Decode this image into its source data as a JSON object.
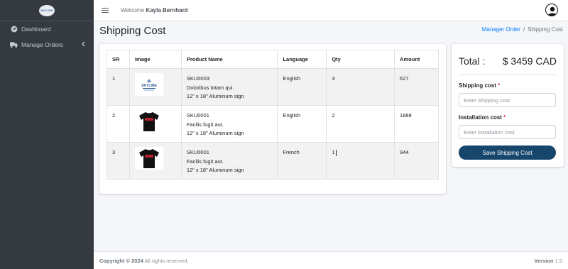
{
  "sidebar": {
    "brand_text": "SKYLINE",
    "items": [
      {
        "label": "Dashboard",
        "icon": "dashboard-icon"
      },
      {
        "label": "Manage Orders",
        "icon": "truck-icon"
      }
    ]
  },
  "topbar": {
    "welcome_prefix": "Welcome",
    "user_name": "Kayla Bernhard"
  },
  "page": {
    "title": "Shipping Cost",
    "breadcrumb": {
      "parent": "Manager Order",
      "separator": "/",
      "current": "Shipping Cost"
    }
  },
  "table": {
    "headers": [
      "SR",
      "Image",
      "Product Name",
      "Language",
      "Qty",
      "Amount"
    ],
    "rows": [
      {
        "sr": "1",
        "image": "logo-sign",
        "sku": "SKU0003",
        "name": "Doloribus totam qui.",
        "size": "12\" x 18\" Aluminum sign",
        "language": "English",
        "qty": "3",
        "amount": "627"
      },
      {
        "sr": "2",
        "image": "black-tshirt",
        "sku": "SKU0001",
        "name": "Facilis fugit aut.",
        "size": "12\" x 18\" Aluminum sign",
        "language": "English",
        "qty": "2",
        "amount": "1888"
      },
      {
        "sr": "3",
        "image": "black-tshirt",
        "sku": "SKU0001",
        "name": "Facilis fugit aut.",
        "size": "12\" x 18\" Aluminum sign",
        "language": "French",
        "qty": "1",
        "amount": "944"
      }
    ]
  },
  "summary": {
    "total_label": "Total :",
    "total_value": "$ 3459 CAD",
    "shipping_label": "Shipping cost",
    "shipping_placeholder": "Enter Shipping cost",
    "installation_label": "Installation cost",
    "installation_placeholder": "Enter Installation cost",
    "required_mark": "*",
    "save_label": "Save Shipping Cost"
  },
  "footer": {
    "copyright_prefix": "Copyright © 2024",
    "copyright_suffix": "All rights reserved.",
    "version_label": "Version",
    "version_value": "1.5"
  },
  "colors": {
    "sidebar_bg": "#343a40",
    "accent_button": "#17466d",
    "link": "#007bff",
    "required": "#dc3545"
  }
}
